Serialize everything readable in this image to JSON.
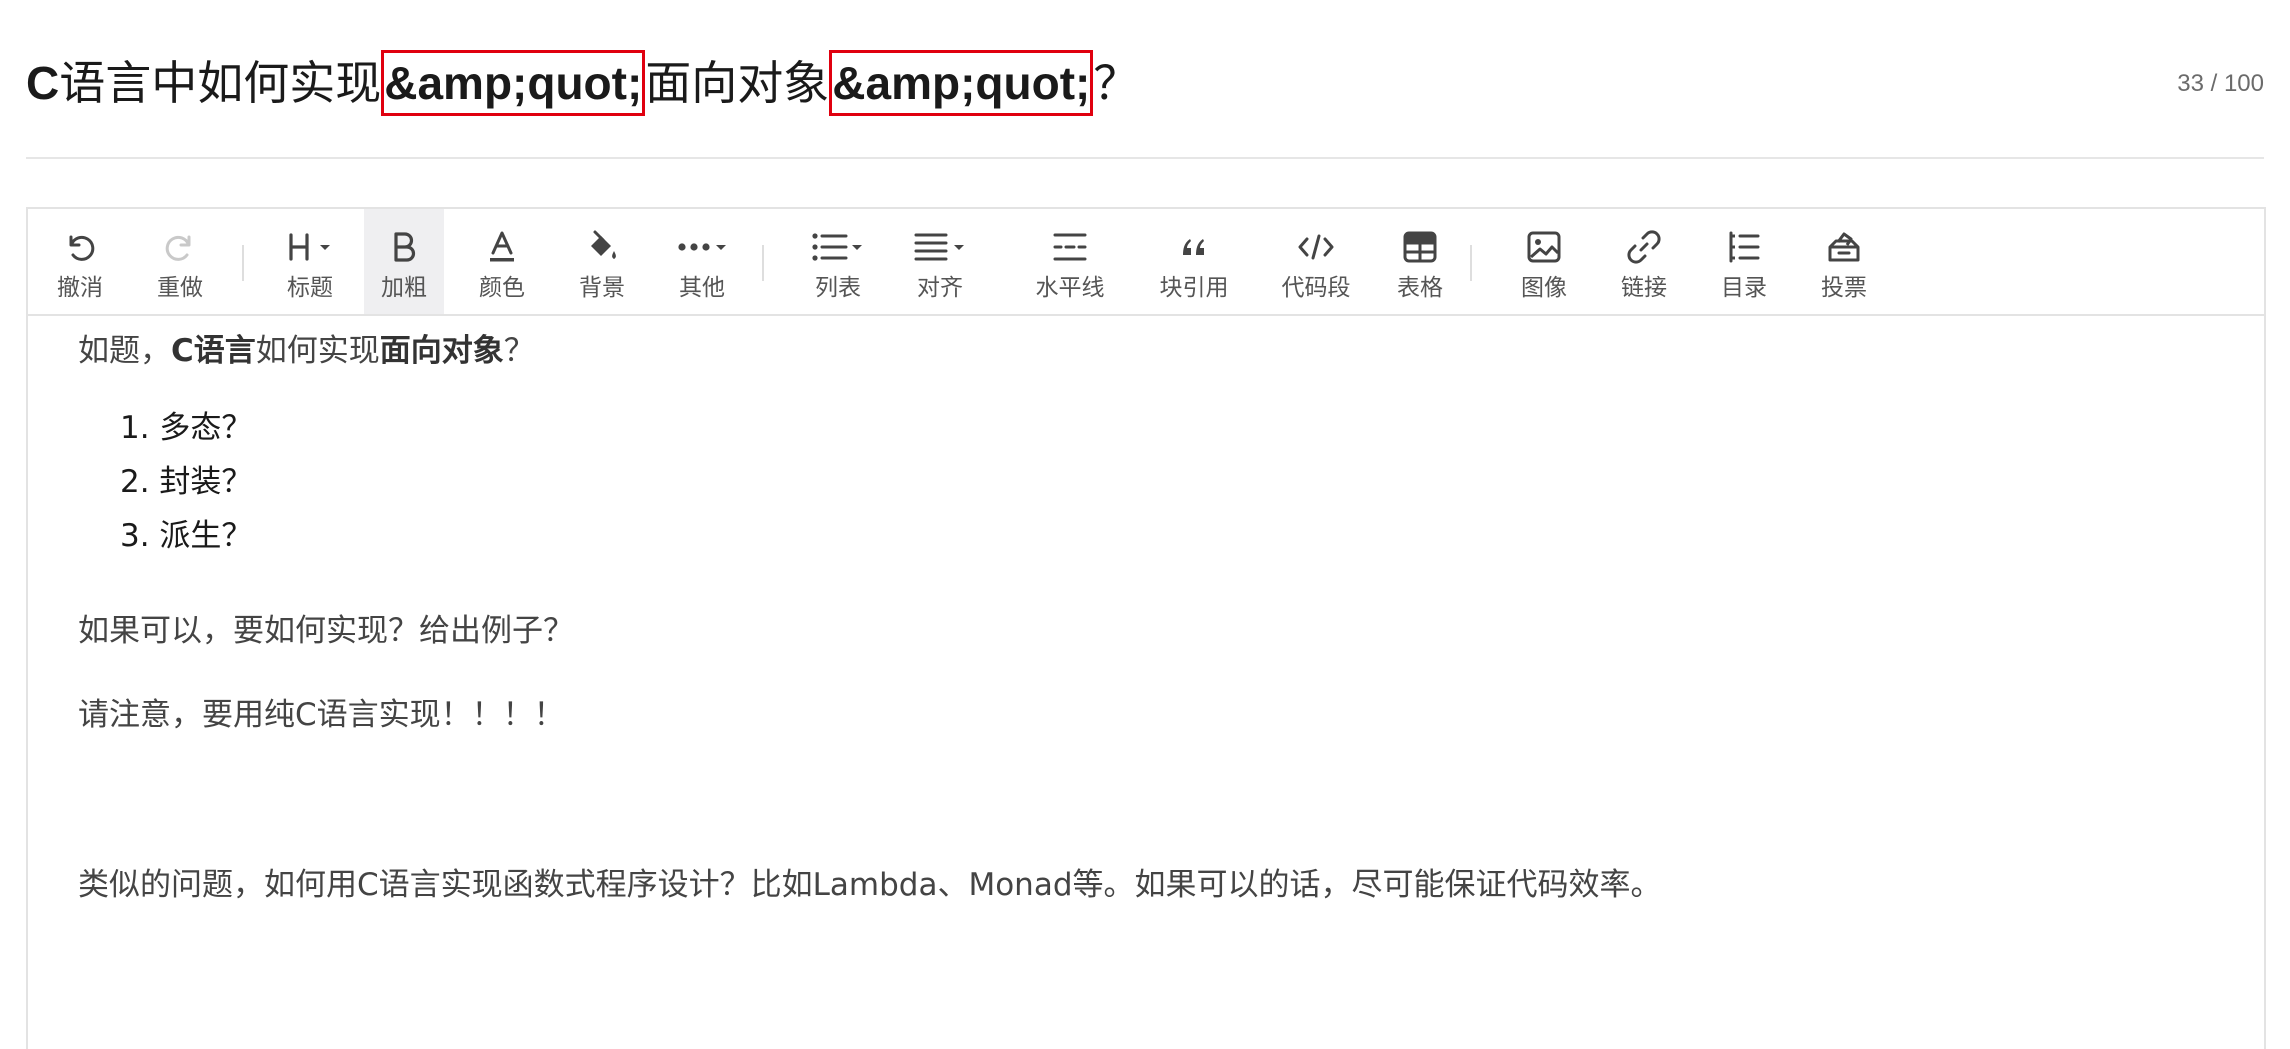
{
  "title": {
    "prefix_bold": "C",
    "part1": "语言中如何实现",
    "boxed1": "&amp;quot;",
    "part2": "面向对象",
    "boxed2": "&amp;quot;",
    "suffix": "？",
    "counter": "33 / 100",
    "box_color": "#e0000f"
  },
  "toolbar": {
    "items": [
      {
        "icon": "undo-icon",
        "label": "撤消"
      },
      {
        "icon": "redo-icon",
        "label": "重做"
      },
      {
        "icon": "heading-icon",
        "label": "标题"
      },
      {
        "icon": "bold-icon",
        "label": "加粗"
      },
      {
        "icon": "font-color-icon",
        "label": "颜色"
      },
      {
        "icon": "paint-bucket-icon",
        "label": "背景"
      },
      {
        "icon": "more-icon",
        "label": "其他"
      },
      {
        "icon": "list-icon",
        "label": "列表"
      },
      {
        "icon": "align-icon",
        "label": "对齐"
      },
      {
        "icon": "horizontal-rule-icon",
        "label": "水平线"
      },
      {
        "icon": "quote-icon",
        "label": "块引用"
      },
      {
        "icon": "code-icon",
        "label": "代码段"
      },
      {
        "icon": "table-icon",
        "label": "表格"
      },
      {
        "icon": "image-icon",
        "label": "图像"
      },
      {
        "icon": "link-icon",
        "label": "链接"
      },
      {
        "icon": "toc-icon",
        "label": "目录"
      },
      {
        "icon": "vote-icon",
        "label": "投票"
      }
    ]
  },
  "content": {
    "intro": {
      "a": "如题，",
      "b": "C语言",
      "c": "如何实现",
      "d": "面向对象",
      "e": "？"
    },
    "list": [
      "1. 多态？",
      "2. 封装？",
      "3. 派生？"
    ],
    "p2": "如果可以，要如何实现？给出例子？",
    "p3": "请注意，要用纯C语言实现！！！！",
    "p4": "类似的问题，如何用C语言实现函数式程序设计？比如Lambda、Monad等。如果可以的话，尽可能保证代码效率。"
  }
}
